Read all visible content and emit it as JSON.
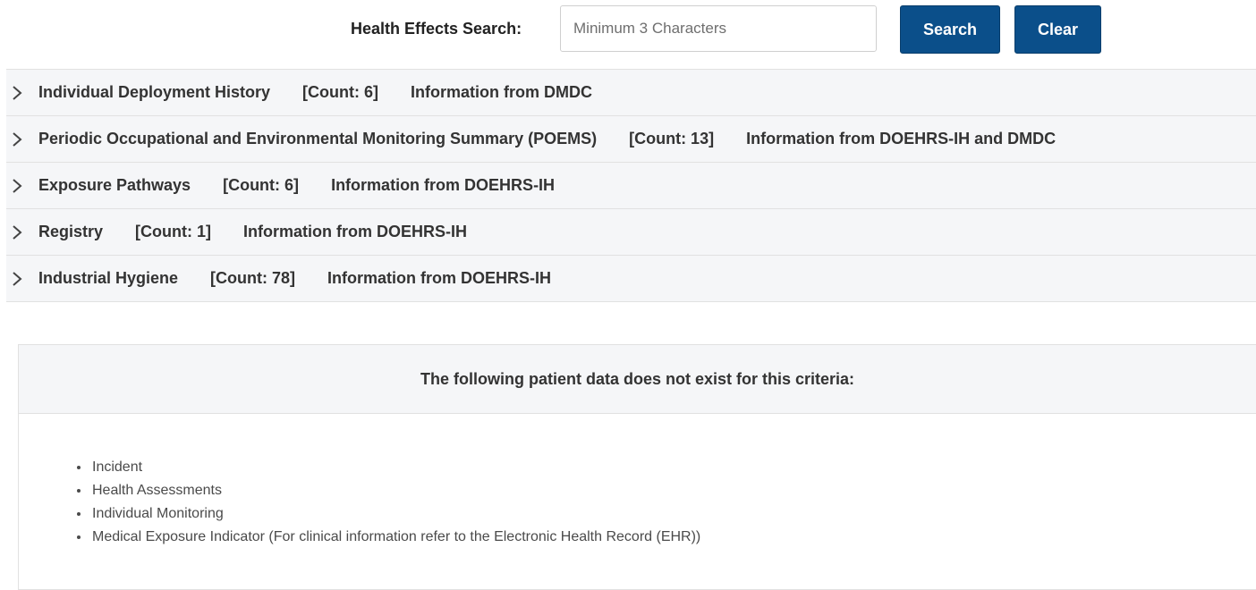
{
  "search": {
    "label": "Health Effects Search:",
    "placeholder": "Minimum 3 Characters",
    "value": "",
    "search_button": "Search",
    "clear_button": "Clear"
  },
  "accordion": [
    {
      "title": "Individual Deployment History",
      "count": "[Count: 6]",
      "source": "Information from DMDC"
    },
    {
      "title": "Periodic Occupational and Environmental Monitoring Summary (POEMS)",
      "count": "[Count: 13]",
      "source": "Information from DOEHRS-IH and DMDC"
    },
    {
      "title": "Exposure Pathways",
      "count": "[Count: 6]",
      "source": "Information from DOEHRS-IH"
    },
    {
      "title": "Registry",
      "count": "[Count: 1]",
      "source": "Information from DOEHRS-IH"
    },
    {
      "title": "Industrial Hygiene",
      "count": "[Count: 78]",
      "source": "Information from DOEHRS-IH"
    }
  ],
  "no_data": {
    "header": "The following patient data does not exist for this criteria:",
    "items": [
      "Incident",
      "Health Assessments",
      "Individual Monitoring",
      "Medical Exposure Indicator (For clinical information refer to the Electronic Health Record (EHR))"
    ]
  },
  "colors": {
    "button_bg": "#0b4f8a",
    "row_bg": "#f5f6f8",
    "border": "#e1e1e1"
  },
  "icons": {
    "accordion_toggle": "chevron-right-icon"
  }
}
